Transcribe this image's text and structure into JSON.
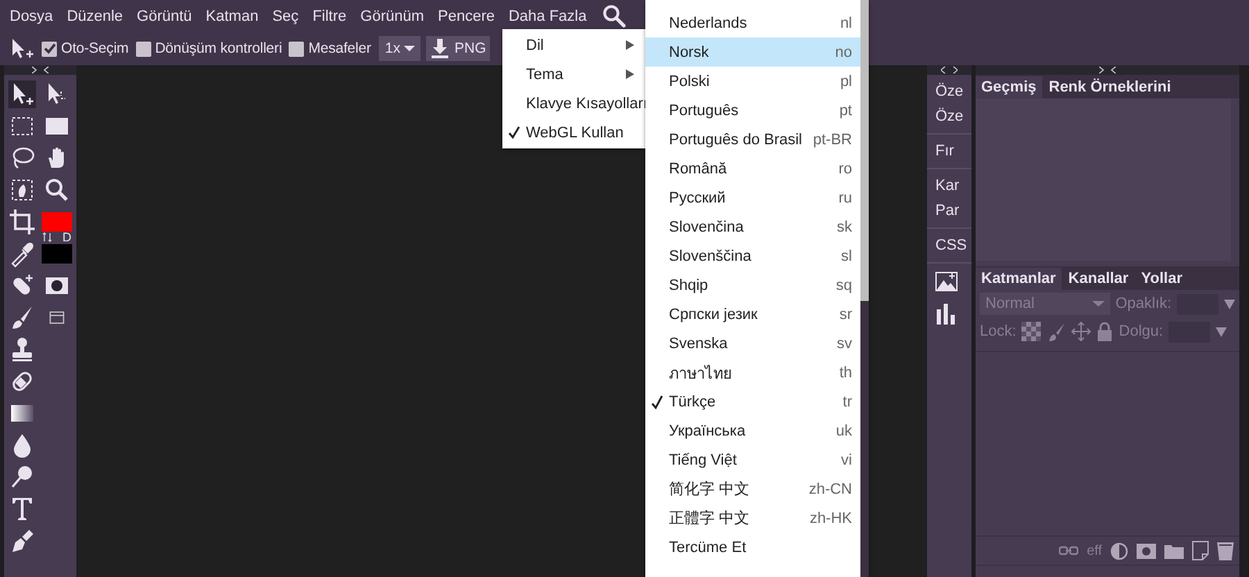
{
  "menu_bar": {
    "items": [
      "Dosya",
      "Düzenle",
      "Görüntü",
      "Katman",
      "Seç",
      "Filtre",
      "Görünüm",
      "Pencere",
      "Daha Fazla"
    ]
  },
  "toolbar": {
    "checkboxes": [
      {
        "label": "Oto-Seçim",
        "checked": true
      },
      {
        "label": "Dönüşüm kontrolleri",
        "checked": false
      },
      {
        "label": "Mesafeler",
        "checked": false
      }
    ],
    "zoom": "1x",
    "export": "PNG"
  },
  "color_swatches": {
    "items": [
      {
        "kind": "foreground",
        "color": "#ff0000"
      },
      {
        "kind": "background",
        "color": "#000000"
      }
    ],
    "default_label": "D"
  },
  "dropdown": {
    "items": [
      {
        "label": "Dil",
        "submenu": true,
        "checked": false
      },
      {
        "label": "Tema",
        "submenu": true,
        "checked": false
      },
      {
        "label": "Klavye Kısayolları",
        "submenu": false,
        "checked": false
      },
      {
        "label": "WebGL Kullan",
        "submenu": false,
        "checked": true
      }
    ]
  },
  "language_menu": {
    "items": [
      {
        "name": "Nederlands",
        "code": "nl",
        "selected": false,
        "checked": false
      },
      {
        "name": "Norsk",
        "code": "no",
        "selected": true,
        "checked": false
      },
      {
        "name": "Polski",
        "code": "pl",
        "selected": false,
        "checked": false
      },
      {
        "name": "Português",
        "code": "pt",
        "selected": false,
        "checked": false
      },
      {
        "name": "Português do Brasil",
        "code": "pt-BR",
        "selected": false,
        "checked": false
      },
      {
        "name": "Română",
        "code": "ro",
        "selected": false,
        "checked": false
      },
      {
        "name": "Русский",
        "code": "ru",
        "selected": false,
        "checked": false
      },
      {
        "name": "Slovenčina",
        "code": "sk",
        "selected": false,
        "checked": false
      },
      {
        "name": "Slovenščina",
        "code": "sl",
        "selected": false,
        "checked": false
      },
      {
        "name": "Shqip",
        "code": "sq",
        "selected": false,
        "checked": false
      },
      {
        "name": "Српски језик",
        "code": "sr",
        "selected": false,
        "checked": false
      },
      {
        "name": "Svenska",
        "code": "sv",
        "selected": false,
        "checked": false
      },
      {
        "name": "ภาษาไทย",
        "code": "th",
        "selected": false,
        "checked": false
      },
      {
        "name": "Türkçe",
        "code": "tr",
        "selected": false,
        "checked": true
      },
      {
        "name": "Українська",
        "code": "uk",
        "selected": false,
        "checked": false
      },
      {
        "name": "Tiếng Việt",
        "code": "vi",
        "selected": false,
        "checked": false
      },
      {
        "name": "简化字 中文",
        "code": "zh-CN",
        "selected": false,
        "checked": false
      },
      {
        "name": "正體字 中文",
        "code": "zh-HK",
        "selected": false,
        "checked": false
      },
      {
        "name": "Tercüme Et",
        "selected": false,
        "checked": false
      }
    ]
  },
  "side_strip": {
    "groups": [
      [
        "Öze",
        "Öze"
      ],
      [
        "Fır"
      ],
      [
        "Kar",
        "Par"
      ],
      [
        "CSS"
      ]
    ]
  },
  "history_panel": {
    "tabs": [
      {
        "label": "Geçmiş",
        "selected": true
      },
      {
        "label": "Renk Örneklerini",
        "selected": false
      }
    ]
  },
  "layers_panel": {
    "tabs": [
      {
        "label": "Katmanlar",
        "selected": true
      },
      {
        "label": "Kanallar",
        "selected": false
      },
      {
        "label": "Yollar",
        "selected": false
      }
    ],
    "blend_mode": "Normal",
    "opacity_label": "Opaklık:",
    "lock_label": "Lock:",
    "fill_label": "Dolgu:",
    "effects_label": "eff"
  }
}
